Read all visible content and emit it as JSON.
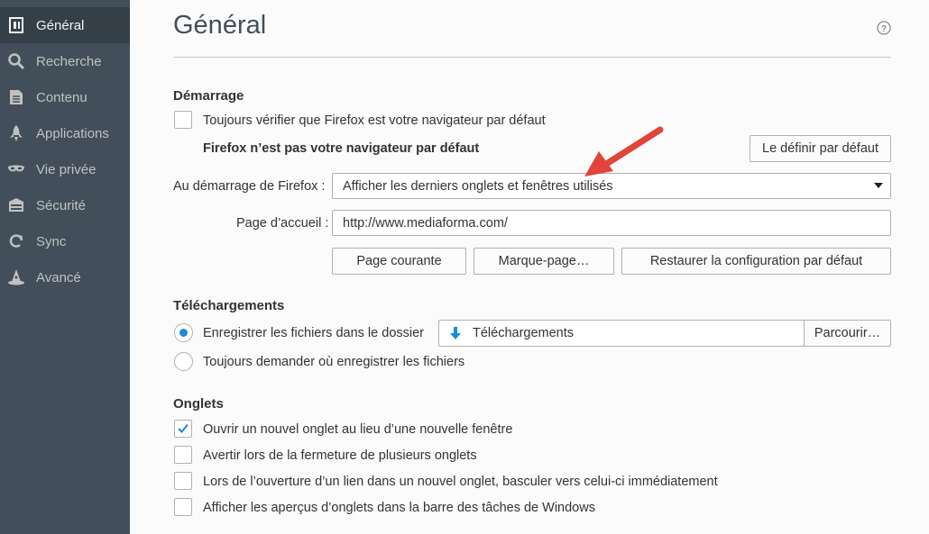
{
  "sidebar": {
    "items": [
      {
        "label": "Général",
        "icon": "general-icon",
        "selected": true
      },
      {
        "label": "Recherche",
        "icon": "search-icon",
        "selected": false
      },
      {
        "label": "Contenu",
        "icon": "document-icon",
        "selected": false
      },
      {
        "label": "Applications",
        "icon": "rocket-icon",
        "selected": false
      },
      {
        "label": "Vie privée",
        "icon": "mask-icon",
        "selected": false
      },
      {
        "label": "Sécurité",
        "icon": "shield-icon",
        "selected": false
      },
      {
        "label": "Sync",
        "icon": "sync-icon",
        "selected": false
      },
      {
        "label": "Avancé",
        "icon": "wizard-hat-icon",
        "selected": false
      }
    ]
  },
  "page": {
    "title": "Général",
    "help_icon": "help-icon"
  },
  "startup": {
    "heading": "Démarrage",
    "default_check_label": "Toujours vérifier que Firefox est votre navigateur par défaut",
    "default_check_checked": false,
    "not_default_text": "Firefox n’est pas votre navigateur par défaut",
    "set_default_button": "Le définir par défaut",
    "on_start_label": "Au démarrage de Firefox :",
    "on_start_value": "Afficher les derniers onglets et fenêtres utilisés",
    "homepage_label": "Page d’accueil :",
    "homepage_value": "http://www.mediaforma.com/",
    "current_page_button": "Page courante",
    "bookmark_button": "Marque-page…",
    "restore_default_button": "Restaurer la configuration par défaut"
  },
  "downloads": {
    "heading": "Téléchargements",
    "save_to_label": "Enregistrer les fichiers dans le dossier",
    "save_to_selected": true,
    "folder_value": "Téléchargements",
    "browse_button": "Parcourir…",
    "always_ask_label": "Toujours demander où enregistrer les fichiers",
    "always_ask_selected": false
  },
  "tabs": {
    "heading": "Onglets",
    "options": [
      {
        "label": "Ouvrir un nouvel onglet au lieu d’une nouvelle fenêtre",
        "checked": true
      },
      {
        "label": "Avertir lors de la fermeture de plusieurs onglets",
        "checked": false
      },
      {
        "label": "Lors de l’ouverture d’un lien dans un nouvel onglet, basculer vers celui-ci immédiatement",
        "checked": false
      },
      {
        "label": "Afficher les aperçus d’onglets dans la barre des tâches de Windows",
        "checked": false
      }
    ]
  },
  "colors": {
    "sidebar": "#424f5a",
    "sidebar_selected": "#343f48",
    "accent": "#1c8bd6",
    "annotation_arrow": "#e0443a"
  }
}
